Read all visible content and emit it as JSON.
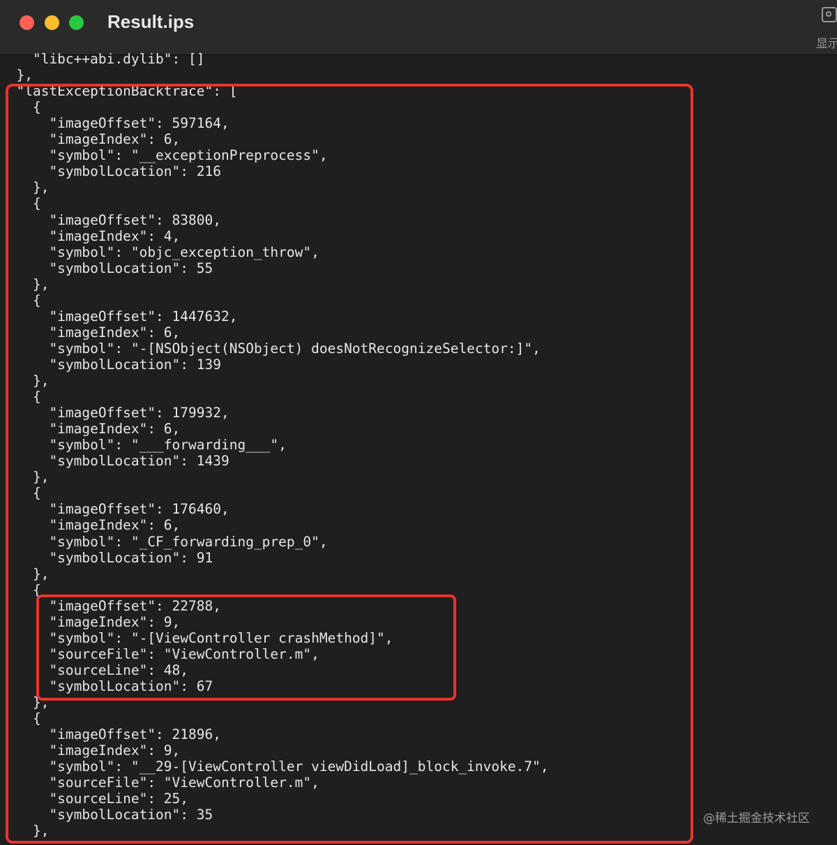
{
  "window": {
    "title": "Result.ips",
    "toolbar_label": "显示"
  },
  "code_lines": [
    "    \"libc++abi.dylib\": []",
    "  },",
    "  \"lastExceptionBacktrace\": [",
    "    {",
    "      \"imageOffset\": 597164,",
    "      \"imageIndex\": 6,",
    "      \"symbol\": \"__exceptionPreprocess\",",
    "      \"symbolLocation\": 216",
    "    },",
    "    {",
    "      \"imageOffset\": 83800,",
    "      \"imageIndex\": 4,",
    "      \"symbol\": \"objc_exception_throw\",",
    "      \"symbolLocation\": 55",
    "    },",
    "    {",
    "      \"imageOffset\": 1447632,",
    "      \"imageIndex\": 6,",
    "      \"symbol\": \"-[NSObject(NSObject) doesNotRecognizeSelector:]\",",
    "      \"symbolLocation\": 139",
    "    },",
    "    {",
    "      \"imageOffset\": 179932,",
    "      \"imageIndex\": 6,",
    "      \"symbol\": \"___forwarding___\",",
    "      \"symbolLocation\": 1439",
    "    },",
    "    {",
    "      \"imageOffset\": 176460,",
    "      \"imageIndex\": 6,",
    "      \"symbol\": \"_CF_forwarding_prep_0\",",
    "      \"symbolLocation\": 91",
    "    },",
    "    {",
    "      \"imageOffset\": 22788,",
    "      \"imageIndex\": 9,",
    "      \"symbol\": \"-[ViewController crashMethod]\",",
    "      \"sourceFile\": \"ViewController.m\",",
    "      \"sourceLine\": 48,",
    "      \"symbolLocation\": 67",
    "    },",
    "    {",
    "      \"imageOffset\": 21896,",
    "      \"imageIndex\": 9,",
    "      \"symbol\": \"__29-[ViewController viewDidLoad]_block_invoke.7\",",
    "      \"sourceFile\": \"ViewController.m\",",
    "      \"sourceLine\": 25,",
    "      \"symbolLocation\": 35",
    "    },"
  ],
  "watermark": "@稀土掘金技术社区",
  "colors": {
    "background": "#1f1f1f",
    "text": "#e6e6e6",
    "highlight_box": "#e8342c"
  }
}
